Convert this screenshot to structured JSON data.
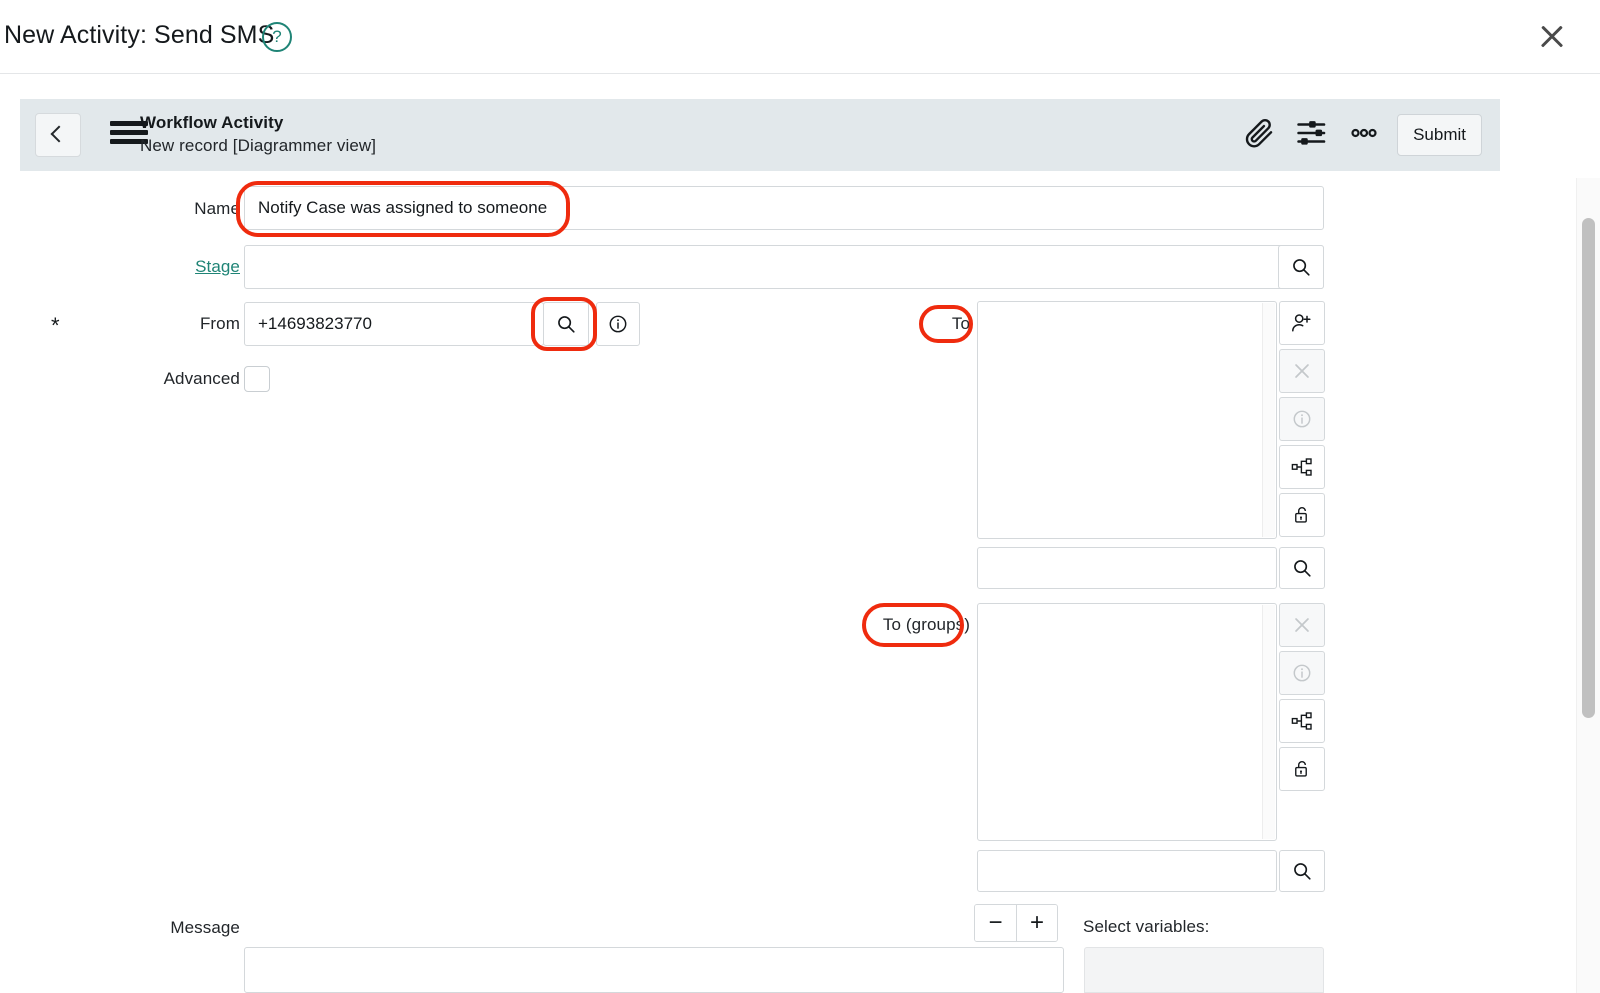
{
  "modal": {
    "title": "New Activity: Send SMS",
    "help_icon": "question-circle-icon",
    "close_icon": "close-icon"
  },
  "toolbar": {
    "back_icon": "chevron-left-icon",
    "menu_icon": "hamburger-menu-icon",
    "title": "Workflow Activity",
    "subtitle": "New record [Diagrammer view]",
    "attachment_icon": "paperclip-icon",
    "personalize_icon": "sliders-icon",
    "more_icon": "three-dots-icon",
    "submit_label": "Submit"
  },
  "form": {
    "name": {
      "label": "Name",
      "value": "Notify Case was assigned to someone",
      "placeholder": ""
    },
    "stage": {
      "label": "Stage",
      "value": "",
      "placeholder": "",
      "search_icon": "magnifier-icon"
    },
    "from": {
      "label": "From",
      "mandatory_marker": "*",
      "value": "+14693823770",
      "placeholder": "",
      "search_icon": "magnifier-icon",
      "info_icon": "info-circle-icon"
    },
    "advanced": {
      "label": "Advanced",
      "checked": false
    },
    "to": {
      "label": "To",
      "items": [],
      "search_value": "",
      "search_placeholder": "",
      "buttons": [
        {
          "name": "add-person-icon",
          "disabled": false
        },
        {
          "name": "remove-icon",
          "disabled": true
        },
        {
          "name": "info-circle-icon",
          "disabled": true
        },
        {
          "name": "hierarchy-icon",
          "disabled": false
        },
        {
          "name": "unlock-icon",
          "disabled": false
        }
      ],
      "search_icon": "magnifier-icon"
    },
    "to_groups": {
      "label": "To (groups)",
      "items": [],
      "search_value": "",
      "search_placeholder": "",
      "buttons": [
        {
          "name": "remove-icon",
          "disabled": true
        },
        {
          "name": "info-circle-icon",
          "disabled": true
        },
        {
          "name": "hierarchy-icon",
          "disabled": false
        },
        {
          "name": "unlock-icon",
          "disabled": false
        }
      ],
      "search_icon": "magnifier-icon"
    },
    "message": {
      "label": "Message",
      "value": "",
      "placeholder": "",
      "decrement_label": "−",
      "increment_label": "+",
      "variables_label": "Select variables:"
    }
  },
  "colors": {
    "accent_teal": "#1f8476",
    "toolbar_bg": "#e2e8eb",
    "annotation_red": "#ef2b0e",
    "text": "#15191c",
    "border": "#d4d8db"
  },
  "annotations": [
    {
      "name": "annotation-name-field"
    },
    {
      "name": "annotation-from-search-button"
    },
    {
      "name": "annotation-to-label"
    },
    {
      "name": "annotation-to-groups-label"
    }
  ]
}
